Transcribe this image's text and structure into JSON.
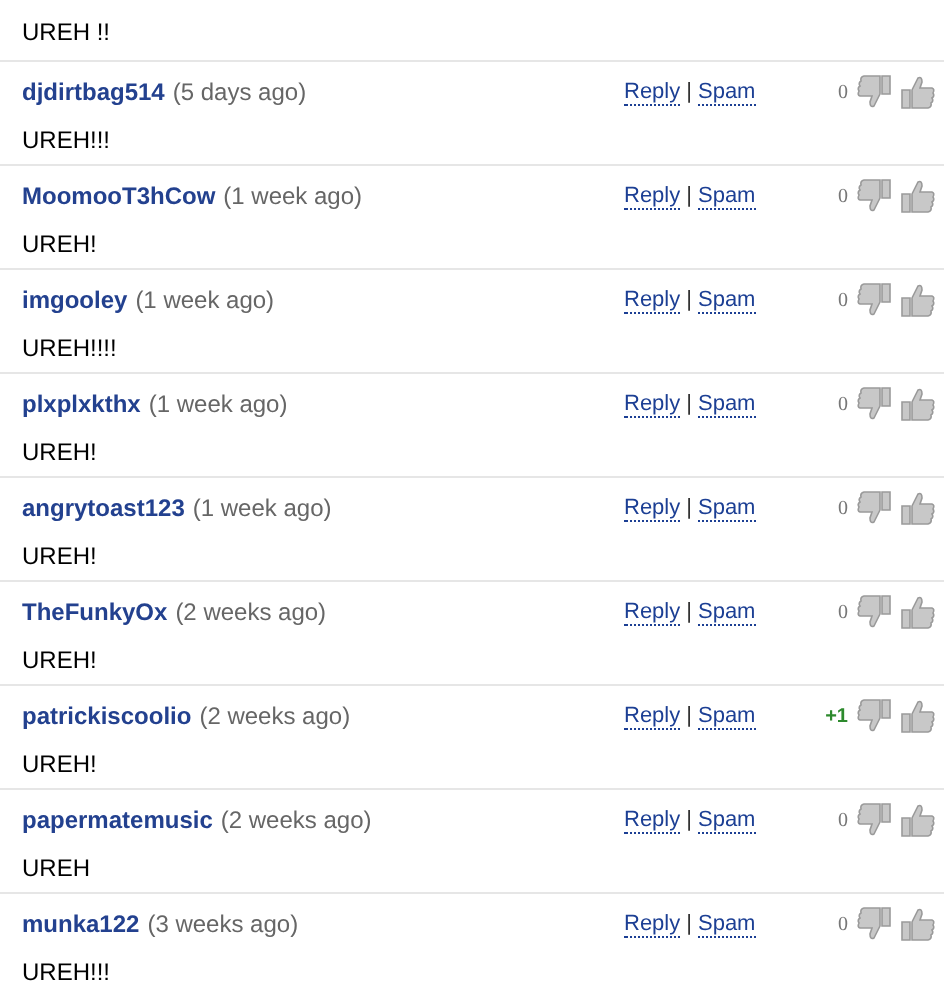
{
  "top_comment": {
    "body": "UREH !!"
  },
  "comments": [
    {
      "user": "djdirtbag514",
      "time": "(5 days ago)",
      "body": "UREH!!!",
      "reply": "Reply",
      "separator": "|",
      "spam": "Spam",
      "score": "0",
      "positive": false
    },
    {
      "user": "MoomooT3hCow",
      "time": "(1 week ago)",
      "body": "UREH!",
      "reply": "Reply",
      "separator": "|",
      "spam": "Spam",
      "score": "0",
      "positive": false
    },
    {
      "user": "imgooley",
      "time": "(1 week ago)",
      "body": "UREH!!!!",
      "reply": "Reply",
      "separator": "|",
      "spam": "Spam",
      "score": "0",
      "positive": false
    },
    {
      "user": "plxplxkthx",
      "time": "(1 week ago)",
      "body": "UREH!",
      "reply": "Reply",
      "separator": "|",
      "spam": "Spam",
      "score": "0",
      "positive": false
    },
    {
      "user": "angrytoast123",
      "time": "(1 week ago)",
      "body": "UREH!",
      "reply": "Reply",
      "separator": "|",
      "spam": "Spam",
      "score": "0",
      "positive": false
    },
    {
      "user": "TheFunkyOx",
      "time": "(2 weeks ago)",
      "body": "UREH!",
      "reply": "Reply",
      "separator": "|",
      "spam": "Spam",
      "score": "0",
      "positive": false
    },
    {
      "user": "patrickiscoolio",
      "time": "(2 weeks ago)",
      "body": "UREH!",
      "reply": "Reply",
      "separator": "|",
      "spam": "Spam",
      "score": "+1",
      "positive": true
    },
    {
      "user": "papermatemusic",
      "time": "(2 weeks ago)",
      "body": "UREH",
      "reply": "Reply",
      "separator": "|",
      "spam": "Spam",
      "score": "0",
      "positive": false
    },
    {
      "user": "munka122",
      "time": "(3 weeks ago)",
      "body": "UREH!!!",
      "reply": "Reply",
      "separator": "|",
      "spam": "Spam",
      "score": "0",
      "positive": false
    }
  ]
}
